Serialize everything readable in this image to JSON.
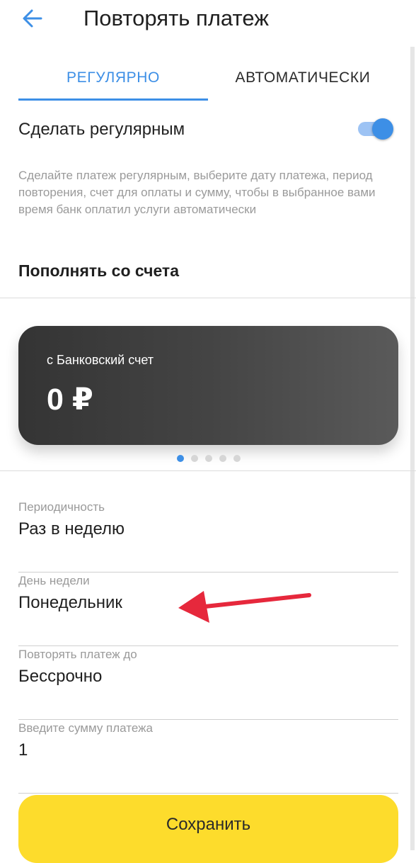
{
  "header": {
    "title": "Повторять платеж"
  },
  "tabs": [
    {
      "label": "РЕГУЛЯРНО",
      "active": true
    },
    {
      "label": "АВТОМАТИЧЕСКИ",
      "active": false
    }
  ],
  "regular": {
    "toggle_label": "Сделать регулярным",
    "toggle_on": true,
    "description": "Сделайте платеж регулярным, выберите дату платежа, период повторения, счет для оплаты и сумму, чтобы в выбранное вами время банк оплатил услуги автоматически"
  },
  "source_section_title": "Пополнять со счета",
  "card": {
    "label": "с Банковский счет",
    "amount": "0 ₽"
  },
  "carousel": {
    "count": 5,
    "active_index": 0
  },
  "fields": {
    "periodicity": {
      "label": "Периодичность",
      "value": "Раз в неделю"
    },
    "weekday": {
      "label": "День недели",
      "value": "Понедельник"
    },
    "repeat_until": {
      "label": "Повторять платеж до",
      "value": "Бессрочно"
    },
    "amount": {
      "label": "Введите сумму платежа",
      "value": "1"
    }
  },
  "save_button": {
    "label": "Сохранить"
  },
  "colors": {
    "accent": "#3d8fe6",
    "save_button": "#fddc2c",
    "annotation_arrow": "#e6283c",
    "card_dark": "#343434"
  }
}
